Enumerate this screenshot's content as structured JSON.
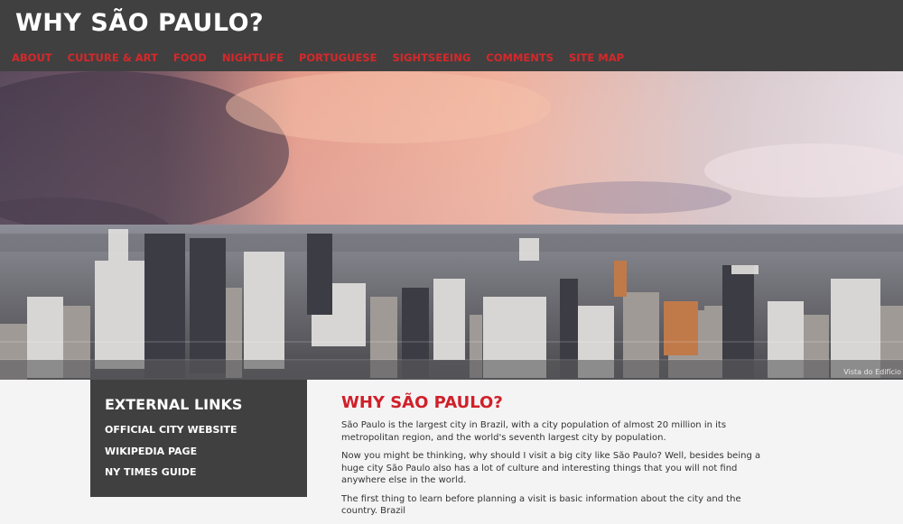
{
  "header": {
    "title": "WHY SÃO PAULO?",
    "nav": [
      "ABOUT",
      "CULTURE & ART",
      "FOOD",
      "NIGHTLIFE",
      "PORTUGUESE",
      "SIGHTSEEING",
      "COMMENTS",
      "SITE MAP"
    ]
  },
  "hero": {
    "credit": "Vista do Edifício"
  },
  "sidebar": {
    "title": "EXTERNAL LINKS",
    "links": [
      "OFFICIAL CITY WEBSITE",
      "WIKIPEDIA PAGE",
      "NY TIMES GUIDE"
    ]
  },
  "main": {
    "title": "WHY SÃO PAULO?",
    "paragraphs": [
      "São Paulo is the largest city in Brazil, with a city population of almost 20 million in its metropolitan region, and the world's seventh largest city by population.",
      "Now you might be thinking, why should I visit a big city like São Paulo? Well, besides being a huge city São Paulo also has a lot of culture and interesting things that you will not find anywhere else in the world.",
      "The first thing to learn before planning a visit is basic information about the city and the country. Brazil"
    ]
  },
  "colors": {
    "header_bg": "#404040",
    "nav_accent": "#d6282a",
    "title_red": "#d0202a",
    "page_bg": "#f4f4f4"
  }
}
